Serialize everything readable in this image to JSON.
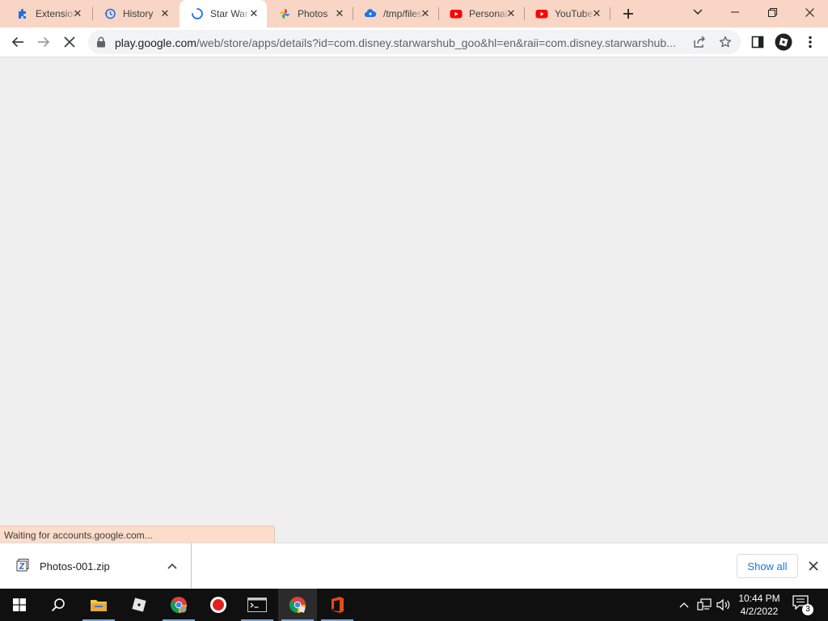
{
  "browser": {
    "tabs": [
      {
        "title": "Extensions",
        "icon": "puzzle-icon"
      },
      {
        "title": "History",
        "icon": "history-icon"
      },
      {
        "title": "Star Wars",
        "icon": "loading-spinner-icon",
        "active": true
      },
      {
        "title": "Photos",
        "icon": "google-photos-icon"
      },
      {
        "title": "/tmp/files",
        "icon": "cloud-upload-icon"
      },
      {
        "title": "Personal",
        "icon": "youtube-icon"
      },
      {
        "title": "YouTube",
        "icon": "youtube-icon"
      }
    ],
    "url_host": "play.google.com",
    "url_rest": "/web/store/apps/details?id=com.disney.starwarshub_goo&hl=en&raii=com.disney.starwarshub..."
  },
  "status_text": "Waiting for accounts.google.com...",
  "downloads": {
    "file_name": "Photos-001.zip",
    "show_all_label": "Show all"
  },
  "taskbar": {
    "time": "10:44 PM",
    "date": "4/2/2022",
    "notification_count": "3"
  },
  "colors": {
    "tabstrip_bg": "#f8d5c4",
    "accent_blue": "#1a73e8",
    "youtube_red": "#ff0000",
    "taskbar_bg": "#101010"
  }
}
